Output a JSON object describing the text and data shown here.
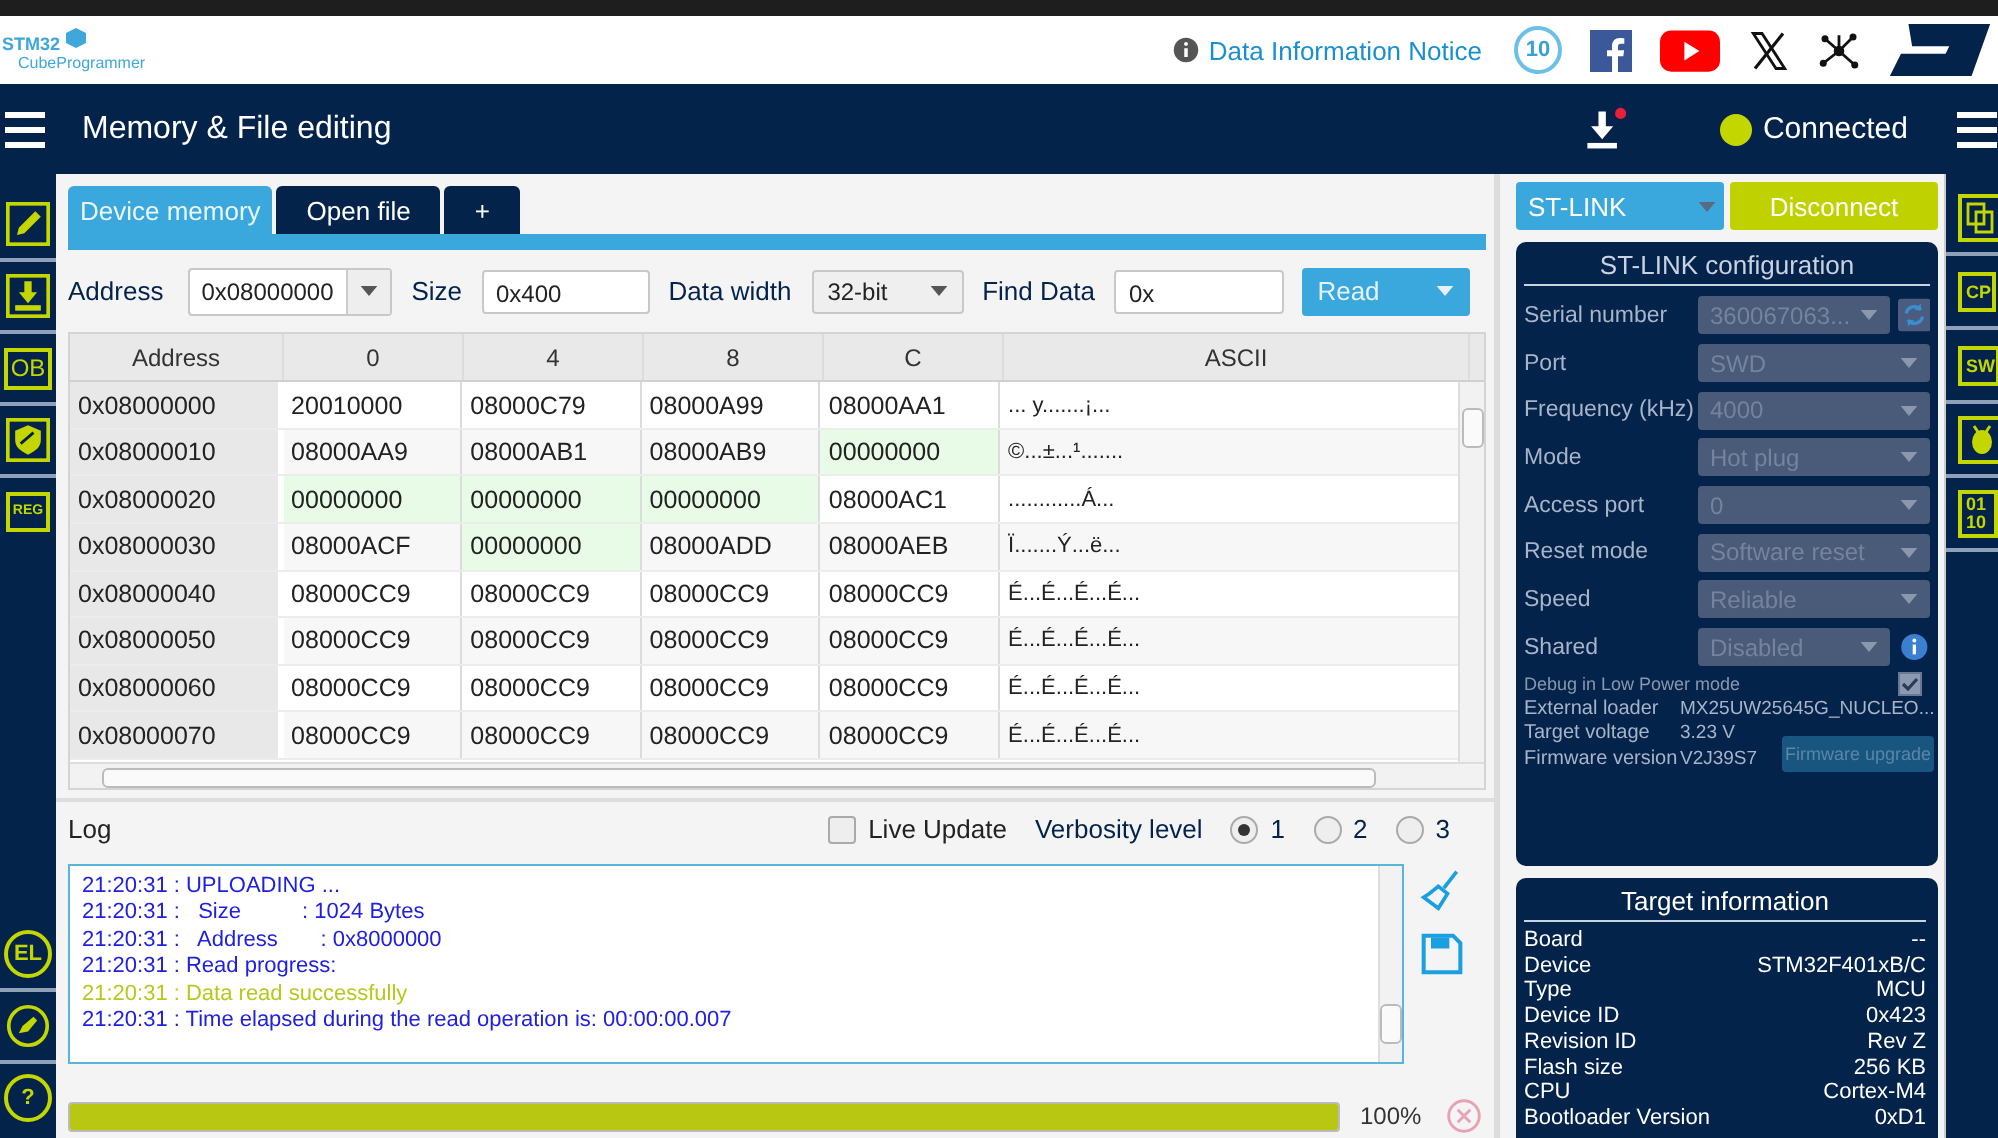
{
  "header": {
    "logo": {
      "line_1": "STM32",
      "line_2": "CubeProgrammer"
    },
    "notice_link": "Data Information Notice",
    "badge": "10"
  },
  "nav": {
    "title": "Memory & File editing",
    "download_pending": true,
    "status": "Connected",
    "connected": true
  },
  "left_sidebar": {
    "top": [
      {
        "kind": "edit"
      },
      {
        "kind": "download"
      },
      {
        "kind": "text",
        "label": "OB"
      },
      {
        "kind": "shield"
      },
      {
        "kind": "text",
        "label": "REG"
      }
    ],
    "bottom": [
      {
        "kind": "circle",
        "label": "EL"
      },
      {
        "kind": "pen"
      },
      {
        "kind": "circle",
        "label": "?"
      }
    ]
  },
  "tabs": [
    {
      "label": "Device memory",
      "selected": true
    },
    {
      "label": "Open file",
      "selected": false
    },
    {
      "label": "+",
      "selected": false
    }
  ],
  "toolbar": {
    "address": {
      "label": "Address",
      "value": "0x08000000"
    },
    "size": {
      "label": "Size",
      "value": "0x400"
    },
    "data_width": {
      "label": "Data width",
      "value": "32-bit"
    },
    "find": {
      "label": "Find Data",
      "value": "0x"
    },
    "read_button": "Read"
  },
  "table": {
    "columns": [
      "Address",
      "0",
      "4",
      "8",
      "C",
      "ASCII"
    ],
    "rows": [
      {
        "cells": [
          {
            "value": "0x08000000",
            "highlighted": false
          },
          {
            "value": "20010000",
            "highlighted": false
          },
          {
            "value": "08000C79",
            "highlighted": false
          },
          {
            "value": "08000A99",
            "highlighted": false
          },
          {
            "value": "08000AA1",
            "highlighted": false
          },
          {
            "value": "... y.......¡...",
            "highlighted": false
          }
        ]
      },
      {
        "cells": [
          {
            "value": "0x08000010",
            "highlighted": false
          },
          {
            "value": "08000AA9",
            "highlighted": false
          },
          {
            "value": "08000AB1",
            "highlighted": false
          },
          {
            "value": "08000AB9",
            "highlighted": false
          },
          {
            "value": "00000000",
            "highlighted": true
          },
          {
            "value": "©...±...¹.......",
            "highlighted": false
          }
        ]
      },
      {
        "cells": [
          {
            "value": "0x08000020",
            "highlighted": false
          },
          {
            "value": "00000000",
            "highlighted": true
          },
          {
            "value": "00000000",
            "highlighted": true
          },
          {
            "value": "00000000",
            "highlighted": true
          },
          {
            "value": "08000AC1",
            "highlighted": false
          },
          {
            "value": "............Á...",
            "highlighted": false
          }
        ]
      },
      {
        "cells": [
          {
            "value": "0x08000030",
            "highlighted": false
          },
          {
            "value": "08000ACF",
            "highlighted": false
          },
          {
            "value": "00000000",
            "highlighted": true
          },
          {
            "value": "08000ADD",
            "highlighted": false
          },
          {
            "value": "08000AEB",
            "highlighted": false
          },
          {
            "value": "Ï.......Ý...ë...",
            "highlighted": false
          }
        ]
      },
      {
        "cells": [
          {
            "value": "0x08000040",
            "highlighted": false
          },
          {
            "value": "08000CC9",
            "highlighted": false
          },
          {
            "value": "08000CC9",
            "highlighted": false
          },
          {
            "value": "08000CC9",
            "highlighted": false
          },
          {
            "value": "08000CC9",
            "highlighted": false
          },
          {
            "value": "É...É...É...É...",
            "highlighted": false
          }
        ]
      },
      {
        "cells": [
          {
            "value": "0x08000050",
            "highlighted": false
          },
          {
            "value": "08000CC9",
            "highlighted": false
          },
          {
            "value": "08000CC9",
            "highlighted": false
          },
          {
            "value": "08000CC9",
            "highlighted": false
          },
          {
            "value": "08000CC9",
            "highlighted": false
          },
          {
            "value": "É...É...É...É...",
            "highlighted": false
          }
        ]
      },
      {
        "cells": [
          {
            "value": "0x08000060",
            "highlighted": false
          },
          {
            "value": "08000CC9",
            "highlighted": false
          },
          {
            "value": "08000CC9",
            "highlighted": false
          },
          {
            "value": "08000CC9",
            "highlighted": false
          },
          {
            "value": "08000CC9",
            "highlighted": false
          },
          {
            "value": "É...É...É...É...",
            "highlighted": false
          }
        ]
      },
      {
        "cells": [
          {
            "value": "0x08000070",
            "highlighted": false
          },
          {
            "value": "08000CC9",
            "highlighted": false
          },
          {
            "value": "08000CC9",
            "highlighted": false
          },
          {
            "value": "08000CC9",
            "highlighted": false
          },
          {
            "value": "08000CC9",
            "highlighted": false
          },
          {
            "value": "É...É...É...É...",
            "highlighted": false
          }
        ]
      }
    ]
  },
  "log": {
    "title": "Log",
    "live_update": {
      "label": "Live Update",
      "checked": false
    },
    "verbosity": {
      "label": "Verbosity level",
      "options": [
        {
          "label": "1",
          "selected": true
        },
        {
          "label": "2",
          "selected": false
        },
        {
          "label": "3",
          "selected": false
        }
      ]
    },
    "lines": [
      {
        "text": "21:20:31 : UPLOADING ...",
        "kind": "info"
      },
      {
        "text": "21:20:31 :   Size          : 1024 Bytes",
        "kind": "info"
      },
      {
        "text": "21:20:31 :   Address       : 0x8000000",
        "kind": "info"
      },
      {
        "text": "21:20:31 : Read progress:",
        "kind": "info"
      },
      {
        "text": "21:20:31 : Data read successfully",
        "kind": "success"
      },
      {
        "text": "21:20:31 : Time elapsed during the read operation is: 00:00:00.007",
        "kind": "info"
      }
    ]
  },
  "progress": {
    "level": 1,
    "reading": "100%"
  },
  "connection": {
    "interface": "ST-LINK",
    "button": "Disconnect"
  },
  "config": {
    "title": "ST-LINK configuration",
    "fields": [
      {
        "label": "Serial number",
        "value": "360067063...",
        "kind": "refresh",
        "disabled": true
      },
      {
        "label": "Port",
        "value": "SWD",
        "kind": "select",
        "disabled": true
      },
      {
        "label": "Frequency (kHz)",
        "value": "4000",
        "kind": "select",
        "disabled": true
      },
      {
        "label": "Mode",
        "value": "Hot plug",
        "kind": "select",
        "disabled": true
      },
      {
        "label": "Access port",
        "value": "0",
        "kind": "select",
        "disabled": true
      },
      {
        "label": "Reset mode",
        "value": "Software reset",
        "kind": "select",
        "disabled": true
      },
      {
        "label": "Speed",
        "value": "Reliable",
        "kind": "select",
        "disabled": true
      },
      {
        "label": "Shared",
        "value": "Disabled",
        "kind": "info",
        "disabled": true
      }
    ],
    "low_power": {
      "label": "Debug in Low Power mode",
      "checked": true
    },
    "info": [
      {
        "label": "External loader",
        "value": "MX25UW25645G_NUCLEO..."
      },
      {
        "label": "Target voltage",
        "value": "3.23 V"
      },
      {
        "label": "Firmware version",
        "value": "V2J39S7"
      }
    ],
    "firmware_button": "Firmware upgrade"
  },
  "target": {
    "title": "Target information",
    "rows": [
      {
        "label": "Board",
        "value": "--"
      },
      {
        "label": "Device",
        "value": "STM32F401xB/C"
      },
      {
        "label": "Type",
        "value": "MCU"
      },
      {
        "label": "Device ID",
        "value": "0x423"
      },
      {
        "label": "Revision ID",
        "value": "Rev Z"
      },
      {
        "label": "Flash size",
        "value": "256 KB"
      },
      {
        "label": "CPU",
        "value": "Cortex-M4"
      },
      {
        "label": "Bootloader Version",
        "value": "0xD1"
      }
    ]
  },
  "right_sidebar": [
    {
      "kind": "pages"
    },
    {
      "kind": "text",
      "label": "CP"
    },
    {
      "kind": "text",
      "label": "SW"
    },
    {
      "kind": "bug"
    },
    {
      "kind": "text",
      "label": "01 10"
    }
  ]
}
